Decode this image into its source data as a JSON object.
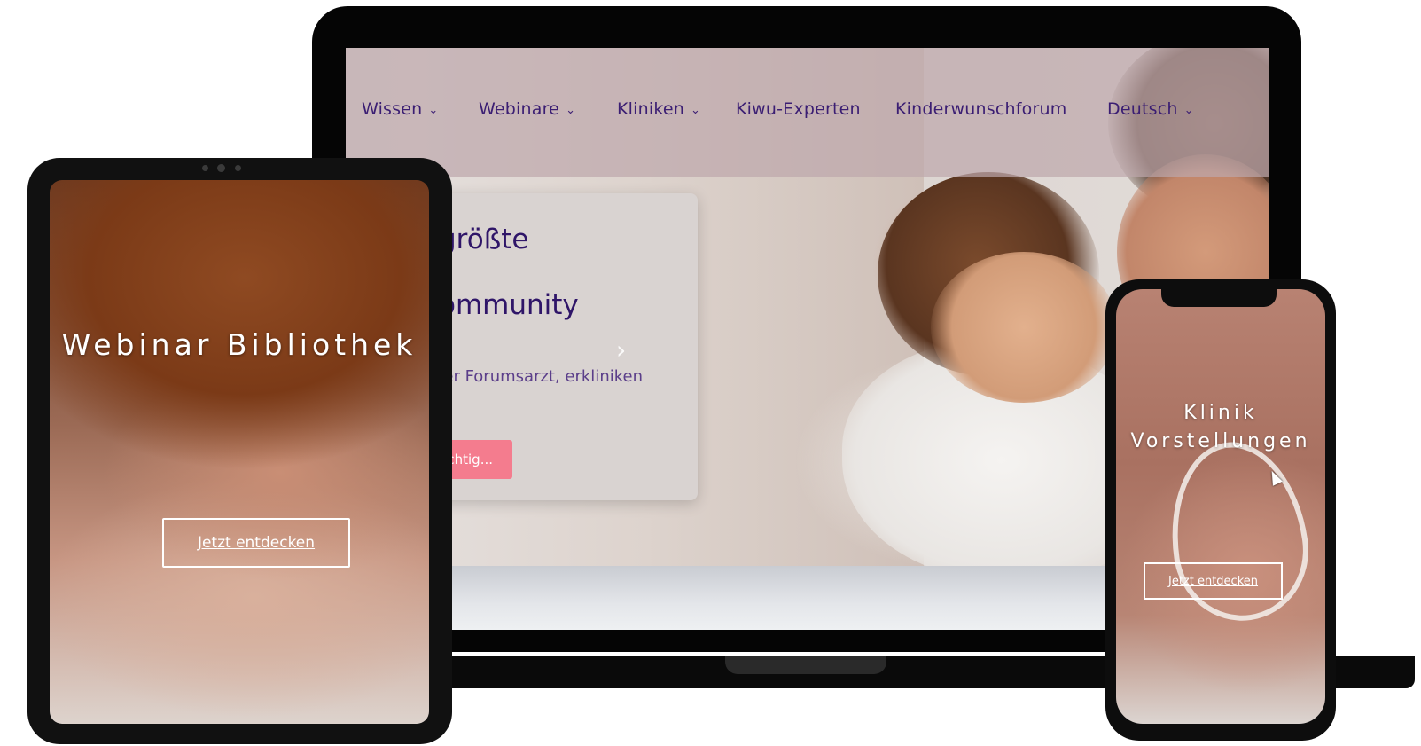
{
  "laptop": {
    "nav": {
      "items": [
        {
          "label": "Wissen",
          "dropdown": true
        },
        {
          "label": "Webinare",
          "dropdown": true
        },
        {
          "label": "Kliniken",
          "dropdown": true
        },
        {
          "label": "Kiwu-Experten",
          "dropdown": false
        },
        {
          "label": "Kinderwunschforum",
          "dropdown": false
        },
        {
          "label": "Deutsch",
          "dropdown": true
        }
      ],
      "chevron": "⌄"
    },
    "hero": {
      "line1": "größte",
      "line2": "ommunity",
      "subtitle": "oser Forumsarzt, erkliniken",
      "button": "ichtig...",
      "next_arrow": "›"
    }
  },
  "tablet": {
    "title": "Webinar Bibliothek",
    "button": "Jetzt entdecken"
  },
  "phone": {
    "title": "Klinik Vorstellungen",
    "button": "Jetzt entdecken"
  },
  "colors": {
    "nav_text": "#3b1e73",
    "hero_text": "#2f1568",
    "cta_button": "#f47c8e"
  }
}
